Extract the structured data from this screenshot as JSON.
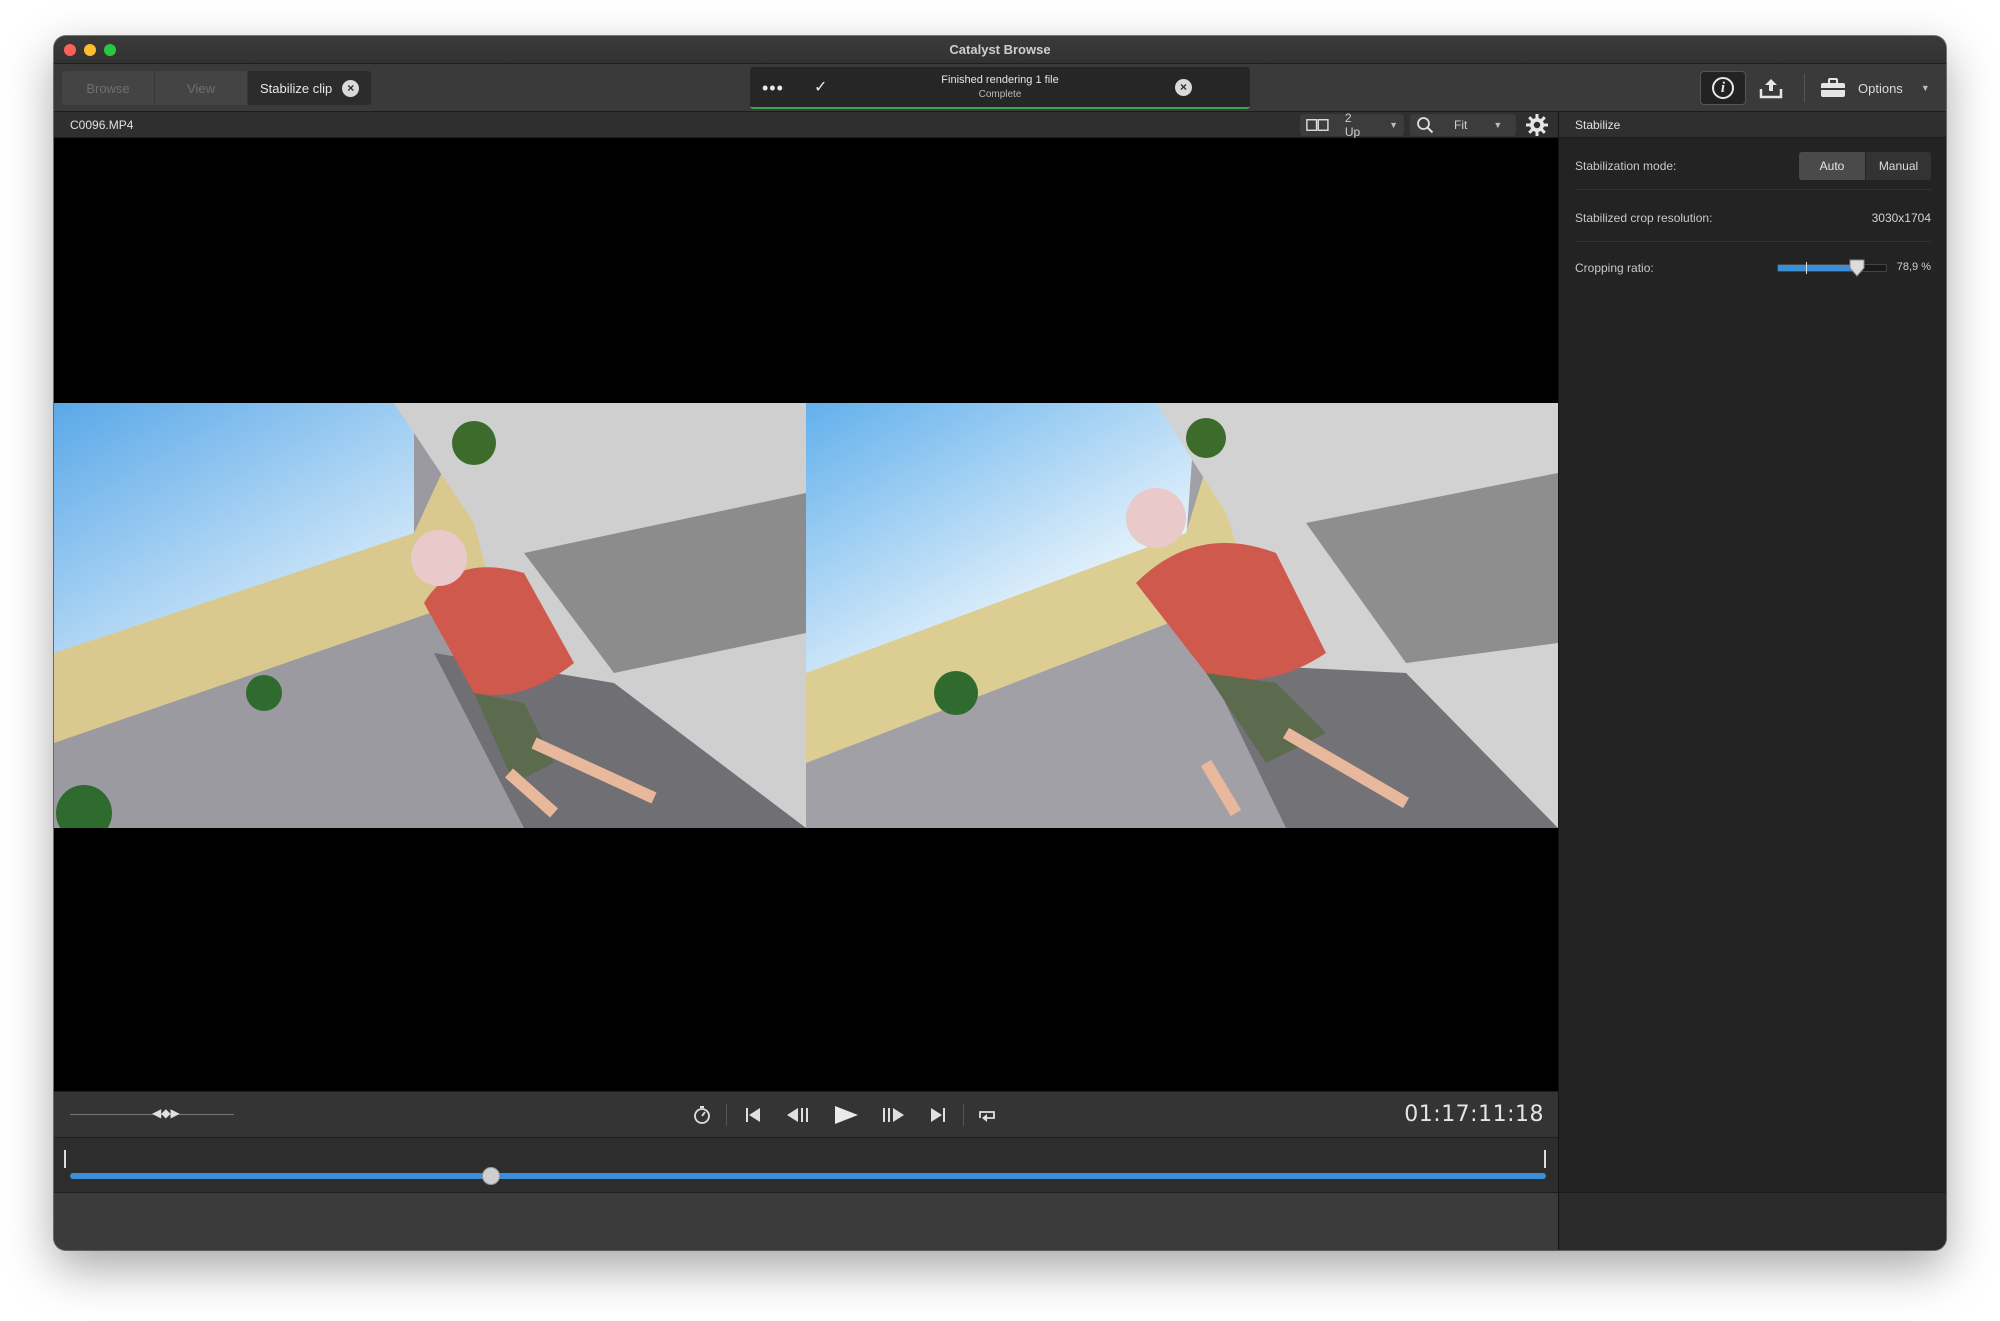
{
  "window": {
    "title": "Catalyst Browse"
  },
  "tabs": [
    {
      "label": "Browse"
    },
    {
      "label": "View"
    },
    {
      "label": "Stabilize clip"
    }
  ],
  "status": {
    "message": "Finished rendering 1 file",
    "sub": "Complete",
    "more_label": "•••",
    "check_label": "✓",
    "accent": "#3aa54a"
  },
  "toolbar": {
    "options_label": "Options"
  },
  "viewer": {
    "filename": "C0096.MP4",
    "layout_label": "2 Up",
    "zoom_label": "Fit"
  },
  "transport": {
    "timecode": "01:17:11:18",
    "playhead_fraction": 0.285
  },
  "inspector": {
    "title": "Stabilize",
    "mode_label": "Stabilization mode:",
    "mode_options": [
      "Auto",
      "Manual"
    ],
    "mode_selected": "Auto",
    "crop_res_label": "Stabilized crop resolution:",
    "crop_res_value": "3030x1704",
    "ratio_label": "Cropping ratio:",
    "ratio_value": "78,9 %",
    "ratio_fraction": 0.72,
    "accent": "#3a8fd6"
  }
}
